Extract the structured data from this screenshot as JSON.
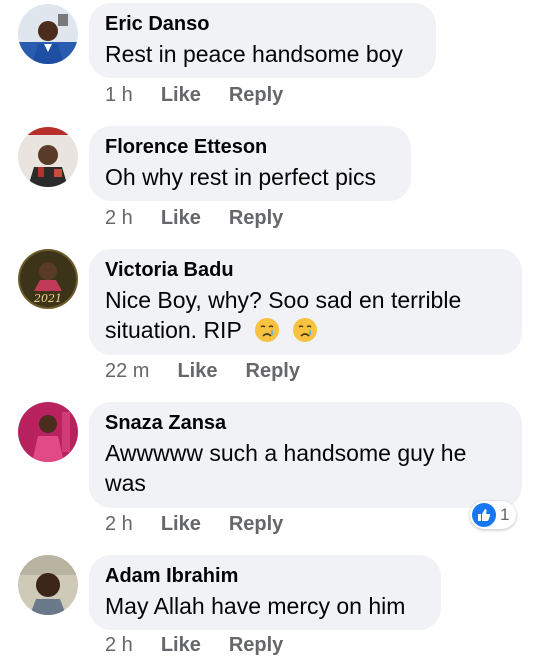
{
  "comments": [
    {
      "author": "Eric Danso",
      "text": "Rest in peace handsome boy",
      "time": "1 h",
      "like_label": "Like",
      "reply_label": "Reply"
    },
    {
      "author": "Florence Etteson",
      "text": "Oh why rest in perfect pics",
      "time": "2 h",
      "like_label": "Like",
      "reply_label": "Reply"
    },
    {
      "author": "Victoria Badu",
      "text_line1": "Nice Boy, why? Soo sad en terrible",
      "text_line2": "situation. RIP",
      "emojis": [
        "crying-face-icon",
        "crying-face-icon"
      ],
      "avatar_caption": "2021",
      "time": "22 m",
      "like_label": "Like",
      "reply_label": "Reply"
    },
    {
      "author": "Snaza Zansa",
      "text_line1": "Awwwww such a handsome guy he",
      "text_line2": "was",
      "time": "2 h",
      "like_label": "Like",
      "reply_label": "Reply",
      "reaction": {
        "icon": "thumbs-up-icon",
        "count": "1"
      }
    },
    {
      "author": "Adam Ibrahim",
      "text": "May Allah have mercy on him",
      "time": "2 h",
      "like_label": "Like",
      "reply_label": "Reply"
    }
  ],
  "colors": {
    "bubble_bg": "#f0f2f5",
    "meta_text": "#65676b",
    "like_blue": "#1877f2"
  }
}
